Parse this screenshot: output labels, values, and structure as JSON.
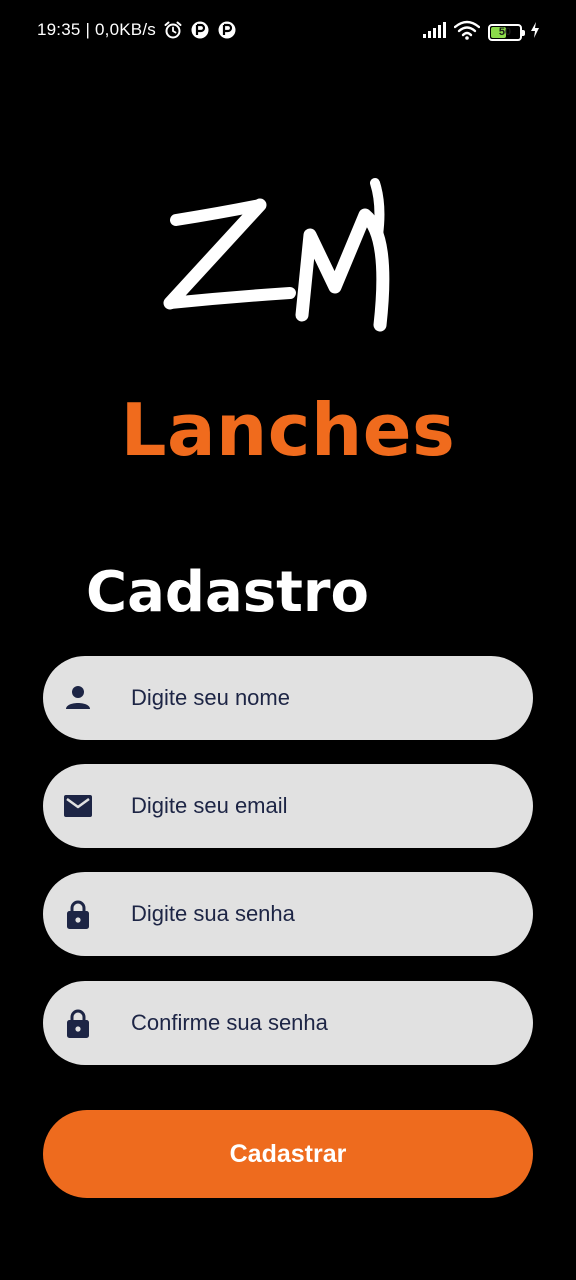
{
  "status_bar": {
    "time_speed": "19:35 | 0,0KB/s",
    "battery_level": "50",
    "battery_color": "#8bd94a",
    "icons_left": [
      "alarm-icon",
      "app-notification-icon",
      "app-notification-icon"
    ],
    "icons_right": [
      "signal-icon",
      "wifi-icon",
      "battery-icon",
      "charging-icon"
    ]
  },
  "brand": {
    "name": "Lanches",
    "color": "#f06b1d"
  },
  "page": {
    "title": "Cadastro"
  },
  "form": {
    "name": {
      "placeholder": "Digite seu nome",
      "value": "",
      "icon": "person-icon"
    },
    "email": {
      "placeholder": "Digite seu email",
      "value": "",
      "icon": "mail-icon"
    },
    "password": {
      "placeholder": "Digite sua senha",
      "value": "",
      "icon": "lock-icon"
    },
    "confirm_password": {
      "placeholder": "Confirme sua senha",
      "value": "",
      "icon": "lock-icon"
    },
    "submit_label": "Cadastrar",
    "accent": "#ee6b1e",
    "field_bg": "#e1e1e1",
    "text_color": "#1d2545"
  }
}
